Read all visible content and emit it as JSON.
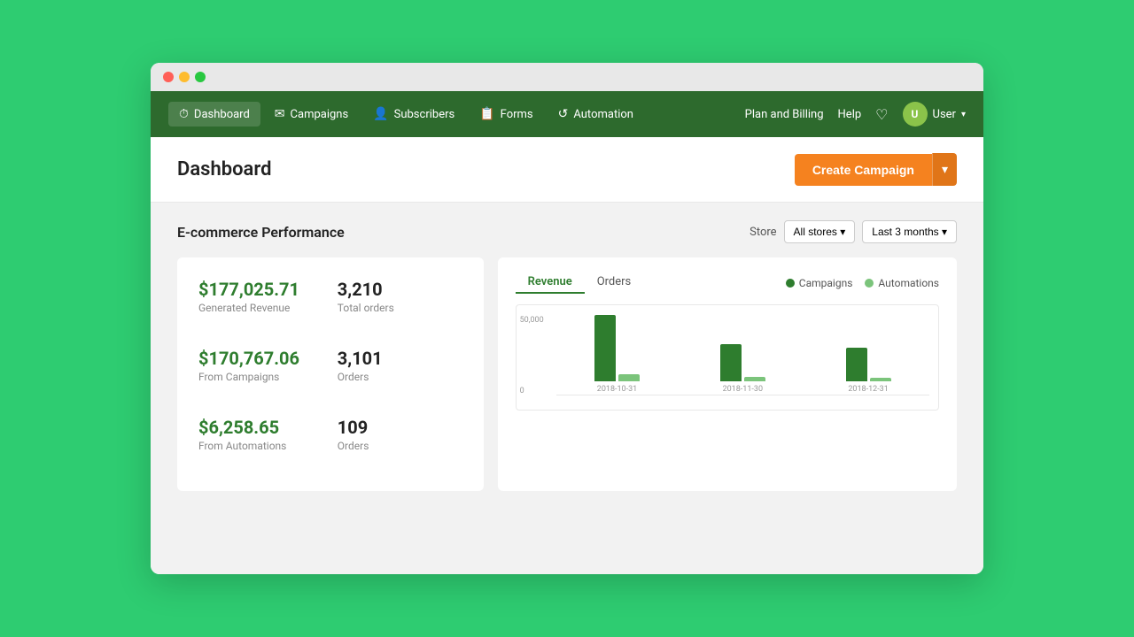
{
  "browser": {
    "dots": [
      "red",
      "yellow",
      "green"
    ]
  },
  "nav": {
    "items": [
      {
        "id": "dashboard",
        "label": "Dashboard",
        "icon": "⏱",
        "active": true
      },
      {
        "id": "campaigns",
        "label": "Campaigns",
        "icon": "✉"
      },
      {
        "id": "subscribers",
        "label": "Subscribers",
        "icon": "👤"
      },
      {
        "id": "forms",
        "label": "Forms",
        "icon": "📋"
      },
      {
        "id": "automation",
        "label": "Automation",
        "icon": "↺"
      }
    ],
    "right": {
      "plan": "Plan and Billing",
      "help": "Help",
      "user": "User"
    }
  },
  "page": {
    "title": "Dashboard",
    "create_campaign_label": "Create Campaign",
    "create_campaign_arrow": "▾"
  },
  "ecommerce": {
    "section_title": "E-commerce Performance",
    "store_label": "Store",
    "store_dropdown": "All stores ▾",
    "time_dropdown": "Last 3 months ▾",
    "stats": {
      "generated_revenue_value": "$177,025.71",
      "generated_revenue_label": "Generated Revenue",
      "total_orders_value": "3,210",
      "total_orders_label": "Total orders",
      "campaigns_revenue_value": "$170,767.06",
      "campaigns_revenue_label": "From Campaigns",
      "campaigns_orders_value": "3,101",
      "campaigns_orders_label": "Orders",
      "automations_revenue_value": "$6,258.65",
      "automations_revenue_label": "From Automations",
      "automations_orders_value": "109",
      "automations_orders_label": "Orders"
    },
    "chart": {
      "tabs": [
        "Revenue",
        "Orders"
      ],
      "active_tab": "Revenue",
      "legend": {
        "campaigns_label": "Campaigns",
        "automations_label": "Automations"
      },
      "bars": [
        {
          "date": "2018-10-31",
          "campaign_height": 75,
          "automation_height": 8
        },
        {
          "date": "2018-11-30",
          "campaign_height": 42,
          "automation_height": 5
        },
        {
          "date": "2018-12-31",
          "campaign_height": 38,
          "automation_height": 4
        }
      ],
      "y_label_top": "50,000",
      "y_label_bottom": "0"
    }
  }
}
